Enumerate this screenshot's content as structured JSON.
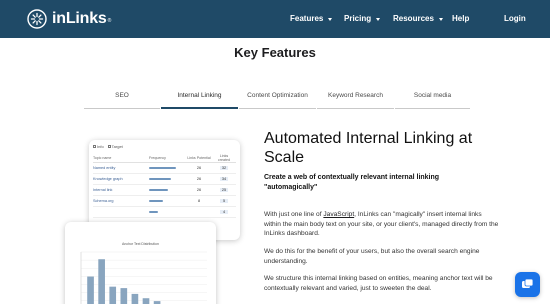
{
  "brand": {
    "name": "inLinks",
    "trademark": "®"
  },
  "nav": {
    "items": [
      {
        "label": "Features",
        "dropdown": true
      },
      {
        "label": "Pricing",
        "dropdown": true
      },
      {
        "label": "Resources",
        "dropdown": true
      },
      {
        "label": "Help",
        "dropdown": false
      },
      {
        "label": "Login",
        "dropdown": false
      }
    ]
  },
  "section": {
    "title": "Key Features"
  },
  "tabs": [
    {
      "label": "SEO",
      "active": false
    },
    {
      "label": "Internal Linking",
      "active": true
    },
    {
      "label": "Content Optimization",
      "active": false
    },
    {
      "label": "Keyword Research",
      "active": false
    },
    {
      "label": "Social media",
      "active": false
    }
  ],
  "table_card": {
    "toolbar": [
      "Info",
      "Target"
    ],
    "columns": [
      "Topic name",
      "Frequency",
      "Links Potential",
      "Links created"
    ],
    "rows": [
      {
        "topic": "Named entity",
        "frequency": 0.9,
        "potential": "26",
        "created": "32"
      },
      {
        "topic": "Knowledge graph",
        "frequency": 0.72,
        "potential": "26",
        "created": "34"
      },
      {
        "topic": "Internal link",
        "frequency": 0.64,
        "potential": "26",
        "created": "25"
      },
      {
        "topic": "Schema.org",
        "frequency": 0.48,
        "potential": "8",
        "created": "5"
      },
      {
        "topic": "",
        "frequency": 0.3,
        "potential": "",
        "created": "4"
      }
    ]
  },
  "chart_card": {
    "title": "Anchor Text Distribution",
    "bar_color": "#89a5bf"
  },
  "chart_data": {
    "type": "bar",
    "title": "Anchor Text Distribution",
    "xlabel": "",
    "ylabel": "",
    "values": [
      28,
      40,
      21,
      20,
      16,
      13,
      11,
      8,
      7,
      5,
      4
    ],
    "ylim": [
      0,
      45
    ],
    "grid": true
  },
  "feature": {
    "heading": "Automated Internal Linking at Scale",
    "subheading": "Create a web of contextually relevant internal linking \"automagically\"",
    "p1_before": "With just one line of ",
    "p1_link": "JavaScript",
    "p1_after": ", InLinks can \"magically\" insert internal links within the main body text on your site, or your client's, managed directly from the InLinks dashboard.",
    "p2": "We do this for the benefit of your users,  but also the overall search engine understanding.",
    "p3": "We structure this internal linking based on entities, meaning anchor text will be contextually relevant and varied, just to sweeten the deal."
  },
  "colors": {
    "navbar": "#1f4a67",
    "accent": "#1a73e8",
    "tab_active": "#1f4a67"
  },
  "icons": {
    "logo": "inlinks-logo-mark",
    "chat": "chat-icon"
  }
}
